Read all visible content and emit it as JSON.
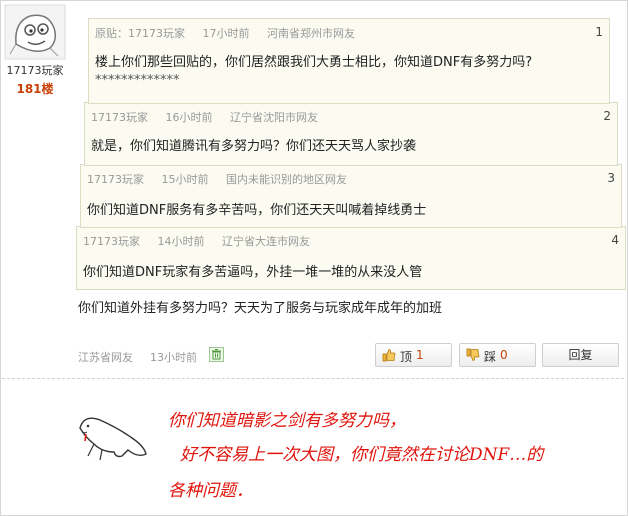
{
  "user": {
    "name": "17173玩家",
    "floor": "181楼"
  },
  "quotes": [
    {
      "label": "原贴：",
      "author": "17173玩家",
      "time": "17小时前",
      "location": "河南省郑州市网友",
      "number": "1",
      "lines": [
        "楼上你们那些回贴的，你们居然跟我们大勇士相比，你知道DNF有多努力吗?",
        "*************"
      ]
    },
    {
      "author": "17173玩家",
      "time": "16小时前",
      "location": "辽宁省沈阳市网友",
      "number": "2",
      "lines": [
        "就是，你们知道腾讯有多努力吗？你们还天天骂人家抄袭"
      ]
    },
    {
      "author": "17173玩家",
      "time": "15小时前",
      "location": "国内未能识别的地区网友",
      "number": "3",
      "lines": [
        "你们知道DNF服务有多辛苦吗，你们还天天叫喊着掉线勇士"
      ]
    },
    {
      "author": "17173玩家",
      "time": "14小时前",
      "location": "辽宁省大连市网友",
      "number": "4",
      "lines": [
        "你们知道DNF玩家有多苦逼吗，外挂一堆一堆的从来没人管"
      ]
    }
  ],
  "post": {
    "text": "你们知道外挂有多努力吗？天天为了服务与玩家成年成年的加班",
    "location": "江苏省网友",
    "time": "13小时前"
  },
  "actions": {
    "up_label": "顶",
    "up_count": "1",
    "down_label": "踩",
    "down_count": "0",
    "reply_label": "回复"
  },
  "annotation": {
    "lines": [
      "你们知道暗影之剑有多努力吗，",
      "好不容易上一次大图，你们竟然在讨论DNF…的",
      "各种问题．"
    ],
    "color": "#e0140c"
  }
}
